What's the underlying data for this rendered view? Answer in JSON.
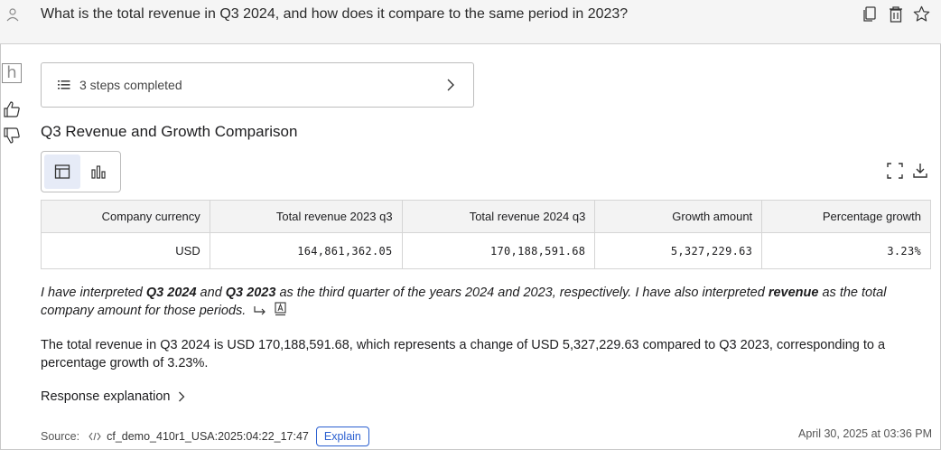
{
  "question": "What is the total revenue in Q3 2024, and how does it compare to the same period in 2023?",
  "header_icons": [
    "copy-icon",
    "trash-icon",
    "star-icon"
  ],
  "left_rail": {
    "badge": "h"
  },
  "steps": {
    "label": "3 steps completed"
  },
  "section_title": "Q3 Revenue and Growth Comparison",
  "view_toggle": {
    "options": [
      "table-view",
      "chart-view"
    ],
    "selected": "table-view"
  },
  "table": {
    "headers": [
      "Company currency",
      "Total revenue 2023 q3",
      "Total revenue 2024 q3",
      "Growth amount",
      "Percentage growth"
    ],
    "rows": [
      [
        "USD",
        "164,861,362.05",
        "170,188,591.68",
        "5,327,229.63",
        "3.23%"
      ]
    ]
  },
  "interpretation": {
    "p1": "I have interpreted ",
    "b1": "Q3 2024",
    "p2": " and ",
    "b2": "Q3 2023",
    "p3": " as the third quarter of the years 2024 and 2023, respectively. I have also interpreted ",
    "b3": "revenue",
    "p4": " as the total company amount for those periods."
  },
  "answer": "The total revenue in Q3 2024 is USD 170,188,591.68, which represents a change of USD 5,327,229.63 compared to Q3 2023, corresponding to a percentage growth of 3.23%.",
  "response_explanation": "Response explanation",
  "footer": {
    "source_label": "Source:",
    "dataset": "cf_demo_410r1_USA:2025:04:22_17:47",
    "explain_label": "Explain",
    "timestamp": "April 30, 2025 at 03:36 PM"
  },
  "colors": {
    "accent": "#2a5fd0",
    "header_bg": "#f5f5f5",
    "toggle_active": "#e6ebf7"
  }
}
